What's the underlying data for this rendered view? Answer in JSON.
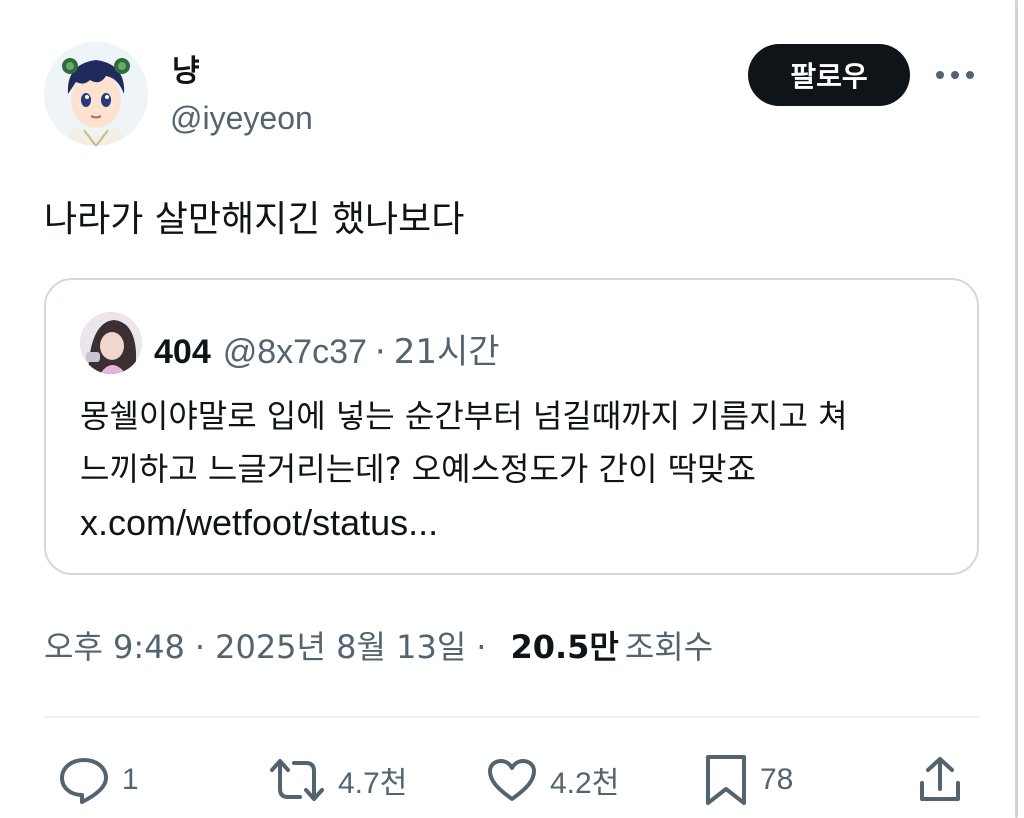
{
  "author": {
    "display_name": "냥",
    "handle": "@iyeyeon"
  },
  "header": {
    "follow_label": "팔로우",
    "more_icon": "more-horizontal-icon"
  },
  "tweet": {
    "text": "나라가 살만해지긴 했나보다"
  },
  "quote": {
    "name": "404",
    "handle": "@8x7c37",
    "dot": "·",
    "time": "21시간",
    "line1": "몽쉘이야말로 입에 넣는 순간부터 넘길때까지 기름지고 쳐",
    "line2": "느끼하고 느글거리는데? 오예스정도가 간이 딱맞죠",
    "link": "x.com/wetfoot/status..."
  },
  "meta": {
    "time": "오후 9:48",
    "sep1": "·",
    "date": "2025년 8월 13일",
    "sep2": "·",
    "views": "20.5만",
    "views_label": "조회수"
  },
  "actions": {
    "replies": "1",
    "reposts": "4.7천",
    "likes": "4.2천",
    "bookmarks": "78"
  },
  "colors": {
    "text_primary": "#0f1419",
    "text_secondary": "#536471",
    "border": "#cfd9de",
    "follow_bg": "#0f1419"
  }
}
